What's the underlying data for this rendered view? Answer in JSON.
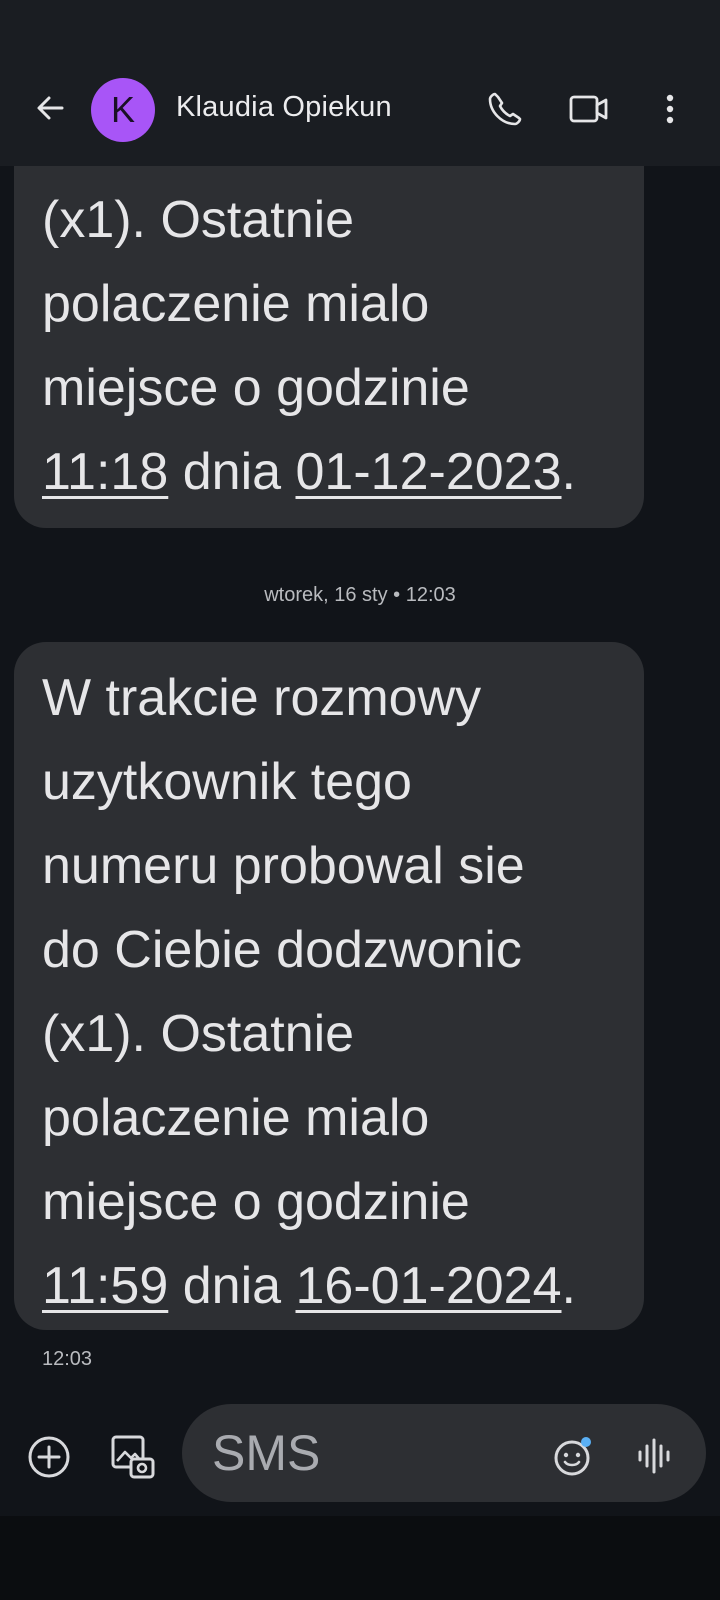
{
  "header": {
    "back_icon": "arrow-back-icon",
    "avatar_letter": "K",
    "avatar_color": "#a855f7",
    "contact_name": "Klaudia Opiekun",
    "actions": [
      "phone-icon",
      "video-call-icon",
      "more-vert-icon"
    ]
  },
  "messages": [
    {
      "lines_before": [
        "(x1). Ostatnie",
        "polaczenie mialo",
        "miejsce o godzinie"
      ],
      "time_link": "11:18",
      "mid_text": " dnia ",
      "date_link": "01-12-2023",
      "end_text": "."
    },
    {
      "divider": "wtorek, 16 sty • 12:03",
      "lines_before": [
        "W trakcie rozmowy",
        "uzytkownik tego",
        "numeru probowal sie",
        "do Ciebie dodzwonic",
        "(x1). Ostatnie",
        "polaczenie mialo",
        "miejsce o godzinie"
      ],
      "time_link": "11:59",
      "mid_text": " dnia ",
      "date_link": "16-01-2024",
      "end_text": ".",
      "sent_time": "12:03"
    }
  ],
  "composer": {
    "placeholder": "SMS",
    "icons": [
      "add-circle-icon",
      "gallery-icon",
      "emoji-icon",
      "voice-waveform-icon"
    ]
  },
  "colors": {
    "background": "#111419",
    "bubble": "#2d2f33",
    "appbar": "#1a1d22"
  }
}
